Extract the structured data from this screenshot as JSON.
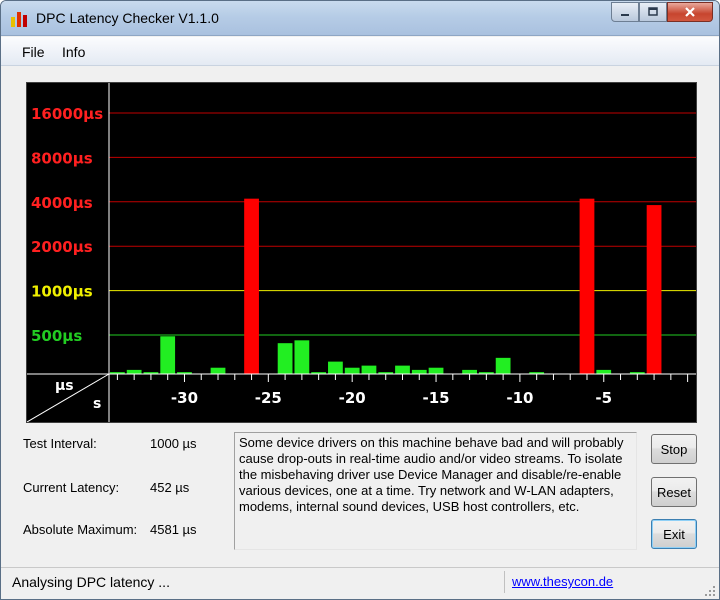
{
  "window": {
    "title": "DPC Latency Checker V1.1.0",
    "controls": {
      "minimize": "minimize-icon",
      "maximize": "maximize-icon",
      "close": "close-icon"
    }
  },
  "menu": {
    "file": "File",
    "info": "Info"
  },
  "chart_data": {
    "type": "bar",
    "title": "",
    "xlabel": "s",
    "ylabel": "µs",
    "y_scale": "log2",
    "y_ticks": [
      {
        "label": "16000µs",
        "value": 16000,
        "color": "#ff2020"
      },
      {
        "label": "8000µs",
        "value": 8000,
        "color": "#ff2020"
      },
      {
        "label": "4000µs",
        "value": 4000,
        "color": "#ff2020"
      },
      {
        "label": "2000µs",
        "value": 2000,
        "color": "#ff2020"
      },
      {
        "label": "1000µs",
        "value": 1000,
        "color": "#f0f000"
      },
      {
        "label": "500µs",
        "value": 500,
        "color": "#22cc22"
      }
    ],
    "x_ticks": [
      {
        "label": "-30",
        "value": -30
      },
      {
        "label": "-25",
        "value": -25
      },
      {
        "label": "-20",
        "value": -20
      },
      {
        "label": "-15",
        "value": -15
      },
      {
        "label": "-10",
        "value": -10
      },
      {
        "label": "-5",
        "value": -5
      }
    ],
    "x_range": [
      -34,
      0
    ],
    "threshold_ok": 1000,
    "color_ok": "#22ee22",
    "color_bad": "#ff0000",
    "grid": true,
    "series": [
      {
        "x": [
          -34,
          -33,
          -32,
          -31,
          -30,
          -29,
          -28,
          -27,
          -26,
          -25,
          -24,
          -23,
          -22,
          -21,
          -20,
          -19,
          -18,
          -17,
          -16,
          -15,
          -14,
          -13,
          -12,
          -11,
          -10,
          -9,
          -8,
          -7,
          -6,
          -5,
          -4,
          -3,
          -2,
          -1,
          0
        ],
        "values": [
          280,
          290,
          280,
          490,
          280,
          250,
          300,
          270,
          4200,
          260,
          440,
          460,
          280,
          330,
          300,
          310,
          280,
          310,
          290,
          300,
          270,
          290,
          280,
          350,
          260,
          280,
          250,
          270,
          4200,
          290,
          270,
          280,
          3800,
          250,
          240
        ]
      }
    ]
  },
  "stats": {
    "test_interval_label": "Test Interval:",
    "test_interval_value": "1000 µs",
    "current_latency_label": "Current Latency:",
    "current_latency_value": "452 µs",
    "absolute_maximum_label": "Absolute Maximum:",
    "absolute_maximum_value": "4581 µs"
  },
  "message": "Some device drivers on this machine behave bad and will probably cause drop-outs in real-time audio and/or video streams. To isolate the misbehaving driver use Device Manager and disable/re-enable various devices, one at a time. Try network and W-LAN adapters, modems, internal sound devices, USB host controllers, etc.",
  "buttons": {
    "stop": "Stop",
    "reset": "Reset",
    "exit": "Exit"
  },
  "status": {
    "text": "Analysing DPC latency ...",
    "link": "www.thesycon.de"
  },
  "icons": {
    "app": "app-icon",
    "grip": "resize-grip-icon"
  },
  "app_icon_colors": [
    "#e8c000",
    "#e03000",
    "#c00000"
  ]
}
